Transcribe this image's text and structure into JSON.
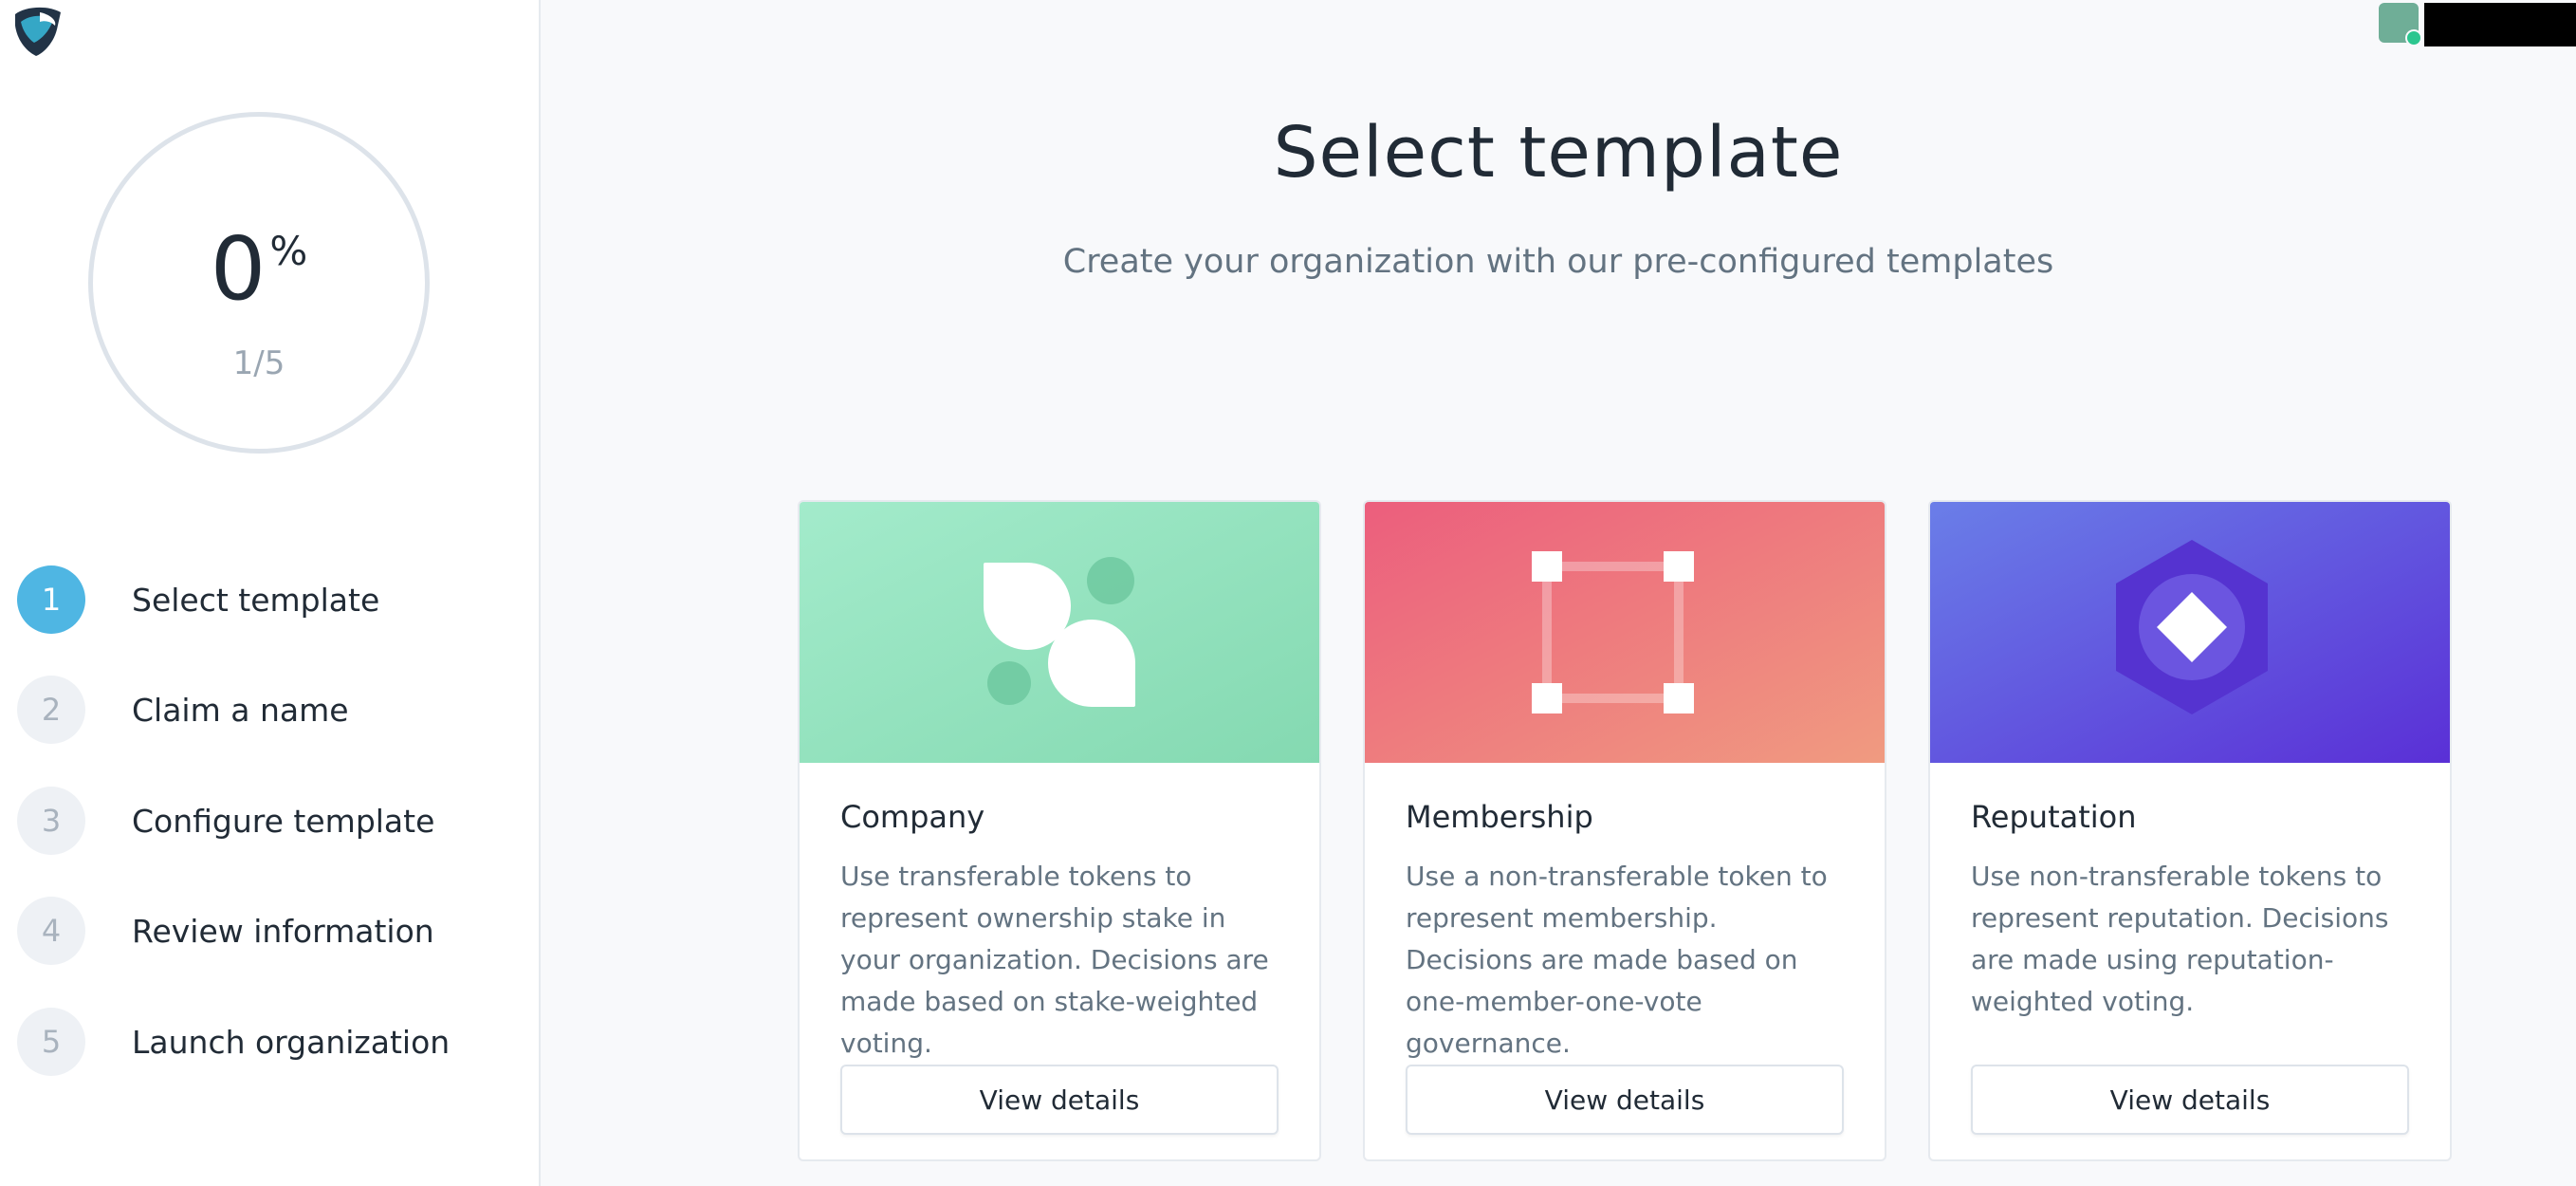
{
  "sidebar": {
    "progress": {
      "value": "0",
      "unit": "%",
      "steps": "1/5"
    },
    "steps": [
      {
        "number": "1",
        "label": "Select template",
        "active": true
      },
      {
        "number": "2",
        "label": "Claim a name",
        "active": false
      },
      {
        "number": "3",
        "label": "Configure template",
        "active": false
      },
      {
        "number": "4",
        "label": "Review information",
        "active": false
      },
      {
        "number": "5",
        "label": "Launch organization",
        "active": false
      }
    ]
  },
  "main": {
    "title": "Select template",
    "subtitle": "Create your organization with our pre-configured templates",
    "templates": [
      {
        "name": "Company",
        "description": "Use transferable tokens to represent ownership stake in your organization. Decisions are made based on stake-weighted voting.",
        "button": "View details",
        "icon": "company-icon",
        "colors": [
          "#a3ebcb",
          "#84d9b1"
        ]
      },
      {
        "name": "Membership",
        "description": "Use a non-transferable token to represent membership. Decisions are made based on one-member-one-vote governance.",
        "button": "View details",
        "icon": "membership-icon",
        "colors": [
          "#ec5e7d",
          "#f09b80"
        ]
      },
      {
        "name": "Reputation",
        "description": "Use non-transferable tokens to represent reputation. Decisions are made using reputation-weighted voting.",
        "button": "View details",
        "icon": "reputation-icon",
        "colors": [
          "#6a7ee8",
          "#5a2fd6"
        ]
      }
    ]
  },
  "colors": {
    "accent": "#4fb6e3",
    "text": "#212b36",
    "muted": "#637381"
  }
}
